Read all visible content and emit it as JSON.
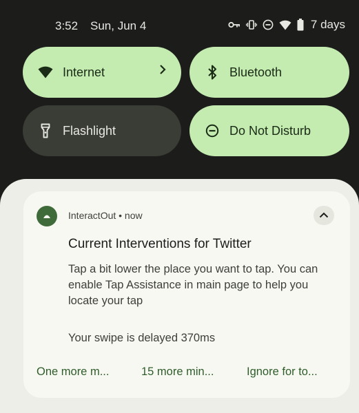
{
  "status_bar": {
    "time": "3:52",
    "date": "Sun, Jun 4",
    "battery_text": "7 days",
    "icons": [
      "key-icon",
      "vibrate-icon",
      "dnd-icon",
      "wifi-icon",
      "battery-icon"
    ]
  },
  "quick_settings": {
    "tiles": [
      {
        "label": "Internet",
        "icon": "wifi-icon",
        "state": "on",
        "has_chevron": true
      },
      {
        "label": "Bluetooth",
        "icon": "bluetooth-icon",
        "state": "on"
      },
      {
        "label": "Flashlight",
        "icon": "flashlight-icon",
        "state": "off"
      },
      {
        "label": "Do Not Disturb",
        "icon": "dnd-icon",
        "state": "on"
      }
    ]
  },
  "notification": {
    "app_name": "InteractOut • now",
    "title": "Current Interventions for Twitter",
    "body": "Tap a bit lower the place you want to tap. You can enable Tap Assistance in main page to help you locate your tap",
    "body_2": "Your swipe is delayed 370ms",
    "actions": [
      "One more m...",
      "15 more min...",
      "Ignore for to..."
    ]
  },
  "colors": {
    "background": "#1c1d1b",
    "tile_on": "#c4ebb0",
    "tile_off": "#3a3c36",
    "shade": "#eeeee8",
    "card": "#f8f8f3",
    "accent": "#2f5d2a"
  }
}
